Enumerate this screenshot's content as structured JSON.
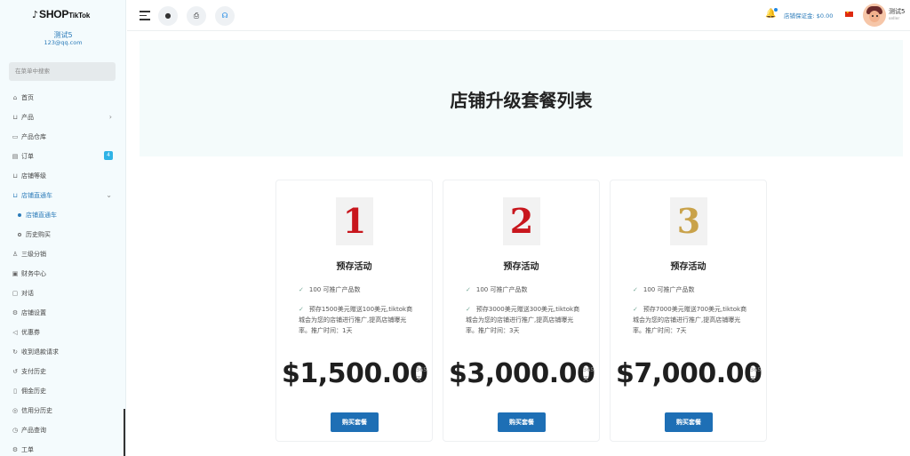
{
  "sidebar": {
    "logo_glyph": "♪",
    "logo_text": "SHOP",
    "logo_small": "TikTok",
    "user_name": "测试5",
    "user_email": "123@qq.com",
    "search_placeholder": "在菜单中搜索",
    "items": [
      {
        "icon": "⌂",
        "label": "首页"
      },
      {
        "icon": "⊔",
        "label": "产品",
        "chevron": "›"
      },
      {
        "icon": "▭",
        "label": "产品仓库"
      },
      {
        "icon": "▤",
        "label": "订单",
        "badge": "4"
      },
      {
        "icon": "⊔",
        "label": "店铺等级"
      },
      {
        "icon": "⊔",
        "label": "店铺直通车",
        "chevron": "⌄"
      },
      {
        "label": "店铺直通车"
      },
      {
        "label": "历史购买"
      },
      {
        "icon": "♙",
        "label": "三级分销"
      },
      {
        "icon": "▣",
        "label": "财务中心"
      },
      {
        "icon": "▢",
        "label": "对话"
      },
      {
        "icon": "⚙",
        "label": "店铺设置"
      },
      {
        "icon": "◁",
        "label": "优惠券"
      },
      {
        "icon": "↻",
        "label": "收到退款请求"
      },
      {
        "icon": "↺",
        "label": "支付历史"
      },
      {
        "icon": "▯",
        "label": "佣金历史"
      },
      {
        "icon": "◎",
        "label": "信用分历史"
      },
      {
        "icon": "◷",
        "label": "产品查询"
      },
      {
        "icon": "⚙",
        "label": "工单"
      }
    ]
  },
  "topbar": {
    "btn1_icon": "●",
    "btn2_icon": "⎙",
    "btn3_icon": "☊",
    "bell_icon": "🔔",
    "deposit_text": "店铺保证金: $0.00",
    "user_name": "测试5",
    "user_role": "seller"
  },
  "main": {
    "title": "店铺升级套餐列表",
    "check_glyph": "✓",
    "cards": [
      {
        "number": "1",
        "title": "预存活动",
        "feature1": "100 可推广产品数",
        "feature2": "预存1500美元赠送100美元,tiktok商城会为您的店铺进行推广,提高店铺曝光率。推广时间：1天",
        "price": "$1,500.00",
        "period": "365 天",
        "buy": "购买套餐"
      },
      {
        "number": "2",
        "title": "预存活动",
        "feature1": "100 可推广产品数",
        "feature2": "预存3000美元赠送300美元,tiktok商城会为您的店铺进行推广,提高店铺曝光率。推广时间：3天",
        "price": "$3,000.00",
        "period": "365 天",
        "buy": "购买套餐"
      },
      {
        "number": "3",
        "title": "预存活动",
        "feature1": "100 可推广产品数",
        "feature2": "预存7000美元赠送700美元,tiktok商城会为您的店铺进行推广,提高店铺曝光率。推广时间：7天",
        "price": "$7,000.00",
        "period": "365 天",
        "buy": "购买套餐"
      }
    ]
  },
  "colors": {
    "accent": "#2b7bb9",
    "button": "#1e6fb5",
    "badge": "#2fb3e6",
    "card1_number": "#c8161d",
    "card2_number": "#c8161d",
    "card3_number": "#c9a24a"
  }
}
